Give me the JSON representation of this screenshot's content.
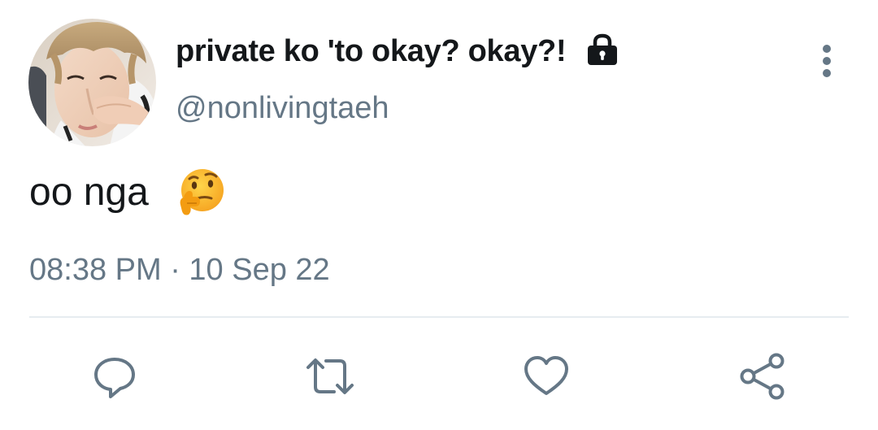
{
  "tweet": {
    "display_name": "private ko 'to okay? okay?!",
    "handle": "@nonlivingtaeh",
    "text": "oo nga",
    "emoji": "thinking-face",
    "timestamp": "08:38 PM · 10 Sep 22",
    "protected_icon": "lock-icon"
  },
  "actions": [
    "reply-icon",
    "retweet-icon",
    "like-icon",
    "share-icon"
  ],
  "colors": {
    "text_primary": "#14171a",
    "text_secondary": "#657786",
    "divider": "#e6ecf0",
    "icon": "#657786"
  }
}
